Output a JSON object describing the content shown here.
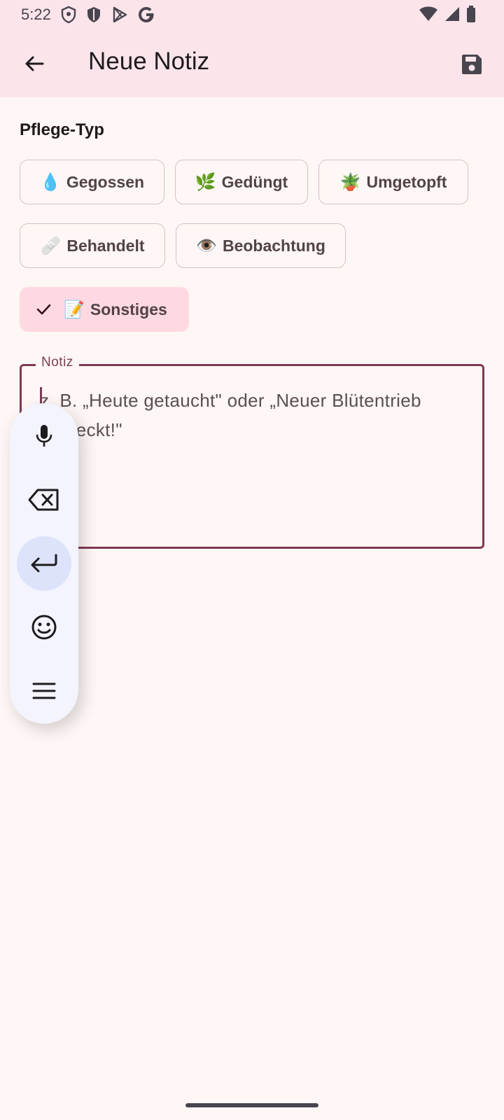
{
  "status_bar": {
    "time": "5:22",
    "left_icons": [
      "vpn-shield-icon",
      "shield-icon",
      "play-store-icon",
      "google-icon"
    ],
    "right_icons": [
      "wifi-icon",
      "signal-icon",
      "battery-icon"
    ]
  },
  "app_bar": {
    "title": "Neue Notiz",
    "back_icon": "arrow-back-icon",
    "save_icon": "save-icon"
  },
  "care_type": {
    "label": "Pflege-Typ",
    "chips": [
      {
        "emoji": "💧",
        "label": "Gegossen",
        "selected": false
      },
      {
        "emoji": "🌿",
        "label": "Gedüngt",
        "selected": false
      },
      {
        "emoji": "🪴",
        "label": "Umgetopft",
        "selected": false
      },
      {
        "emoji": "🩹",
        "label": "Behandelt",
        "selected": false
      },
      {
        "emoji": "👁️",
        "label": "Beobachtung",
        "selected": false
      },
      {
        "emoji": "📝",
        "label": "Sonstiges",
        "selected": true
      }
    ]
  },
  "note_field": {
    "label": "Notiz",
    "placeholder": "z. B. „Heute getaucht\" oder „Neuer Blütentrieb entdeckt!\"",
    "value": ""
  },
  "floating_keyboard": {
    "buttons": [
      "mic-icon",
      "backspace-icon",
      "enter-icon",
      "emoji-icon",
      "menu-icon"
    ],
    "active": "enter-icon"
  },
  "colors": {
    "appbar_bg": "#FBE4EA",
    "background": "#FFF7F5",
    "accent": "#7d3a55",
    "selected_chip": "#FFD9E1"
  }
}
